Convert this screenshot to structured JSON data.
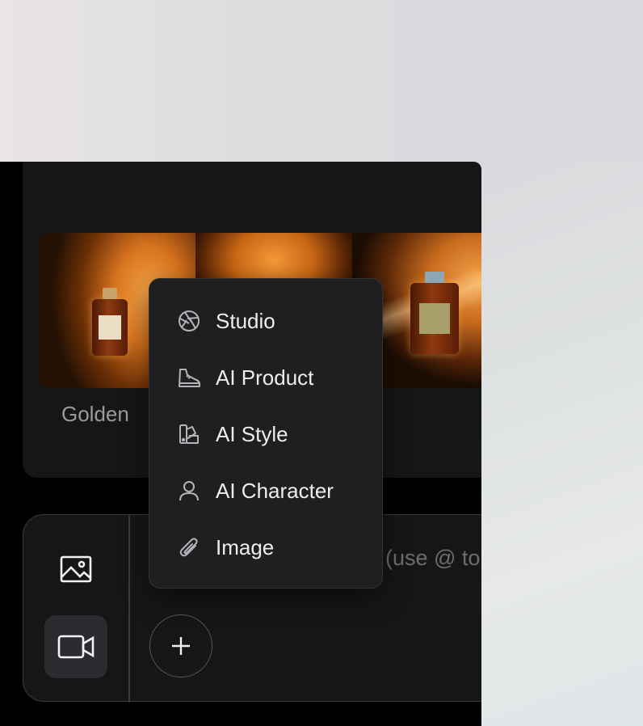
{
  "preset": {
    "caption": "Golden",
    "thumbnails": [
      {
        "label_text": "CHANEL"
      },
      {
        "label_text": ""
      },
      {
        "label_text": "CHANEL"
      }
    ]
  },
  "composer": {
    "placeholder": "(use @ to",
    "modes": [
      {
        "name": "image",
        "icon": "image-icon",
        "selected": false
      },
      {
        "name": "video",
        "icon": "video-camera-icon",
        "selected": true
      }
    ],
    "add_icon": "plus-icon"
  },
  "menu": {
    "items": [
      {
        "label": "Studio",
        "icon": "aperture-icon"
      },
      {
        "label": "AI Product",
        "icon": "sneaker-icon"
      },
      {
        "label": "AI Style",
        "icon": "swatch-icon"
      },
      {
        "label": "AI Character",
        "icon": "person-icon"
      },
      {
        "label": "Image",
        "icon": "paperclip-icon"
      }
    ]
  },
  "colors": {
    "app_background": "#000000",
    "card": "#161617",
    "menu": "#1f1f21",
    "menu_text": "#ededef",
    "muted_text": "#9a9a9e"
  }
}
